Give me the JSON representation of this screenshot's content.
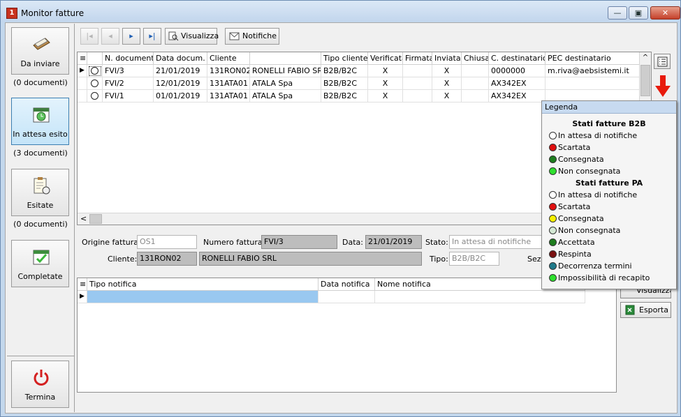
{
  "window": {
    "title": "Monitor fatture",
    "minimize": "▭",
    "maximize": "▣",
    "close": "✕"
  },
  "nav": [
    {
      "label": "Da inviare",
      "count": "(0 documenti)",
      "icon": "send-documents-icon"
    },
    {
      "label": "In attesa esito",
      "count": "(3 documenti)",
      "icon": "pending-calendar-icon"
    },
    {
      "label": "Esitate",
      "count": "(0 documenti)",
      "icon": "clipboard-clock-icon"
    },
    {
      "label": "Completate",
      "count": "",
      "icon": "calendar-check-icon"
    }
  ],
  "terminate": {
    "label": "Termina",
    "icon": "power-icon"
  },
  "toolbar": {
    "first": "|◂",
    "prev": "◂",
    "next": "▸",
    "last": "▸|",
    "visualizza": "Visualizza",
    "notifiche": "Notifiche"
  },
  "grid": {
    "columns": [
      "≡",
      "N. documento",
      "Data docum.",
      "Cliente",
      "",
      "Tipo cliente",
      "Verificata",
      "Firmata",
      "Inviata",
      "Chiusa",
      "C. destinatario",
      "PEC destinatario"
    ],
    "rows": [
      {
        "doc": "FVI/3",
        "date": "21/01/2019",
        "client": "131RON02",
        "name": "RONELLI FABIO SRL",
        "type": "B2B/B2C",
        "verificata": "X",
        "firmata": "",
        "inviata": "X",
        "chiusa": "",
        "dest": "0000000",
        "pec": "m.riva@aebsistemi.it"
      },
      {
        "doc": "FVI/2",
        "date": "12/01/2019",
        "client": "131ATA01",
        "name": "ATALA Spa",
        "type": "B2B/B2C",
        "verificata": "X",
        "firmata": "",
        "inviata": "X",
        "chiusa": "",
        "dest": "AX342EX",
        "pec": ""
      },
      {
        "doc": "FVI/1",
        "date": "01/01/2019",
        "client": "131ATA01",
        "name": "ATALA Spa",
        "type": "B2B/B2C",
        "verificata": "X",
        "firmata": "",
        "inviata": "X",
        "chiusa": "",
        "dest": "AX342EX",
        "pec": ""
      }
    ],
    "scroll_left": "<",
    "scroll_up": "^"
  },
  "form": {
    "origine_label": "Origine fattura:",
    "origine_value": "OS1",
    "numero_label": "Numero fattura:",
    "numero_value": "FVI/3",
    "data_label": "Data:",
    "data_value": "21/01/2019",
    "stato_label": "Stato:",
    "stato_value": "In attesa di notifiche",
    "cliente_label": "Cliente:",
    "cliente_code": "131RON02",
    "cliente_name": "RONELLI FABIO SRL",
    "tipo_label": "Tipo:",
    "tipo_value": "B2B/B2C",
    "sez_label": "Sezi"
  },
  "notif_grid": {
    "columns": [
      "≡",
      "Tipo notifica",
      "Data notifica",
      "Nome notifica"
    ]
  },
  "right_buttons": {
    "visualizza": "Visualizza",
    "esporta": "Esporta"
  },
  "legend": {
    "title": "Legenda",
    "b2b_title": "Stati fatture B2B",
    "b2b": [
      {
        "label": "In attesa di notifiche",
        "color": "#ffffff"
      },
      {
        "label": "Scartata",
        "color": "#e01010"
      },
      {
        "label": "Consegnata",
        "color": "#1e7d1e"
      },
      {
        "label": "Non consegnata",
        "color": "#2ee02e"
      }
    ],
    "pa_title": "Stati fatture PA",
    "pa": [
      {
        "label": "In attesa di notifiche",
        "color": "#ffffff"
      },
      {
        "label": "Scartata",
        "color": "#e01010"
      },
      {
        "label": "Consegnata",
        "color": "#f5f000"
      },
      {
        "label": "Non consegnata",
        "color": "#d4e8d4"
      },
      {
        "label": "Accettata",
        "color": "#1e7d1e"
      },
      {
        "label": "Respinta",
        "color": "#7a1010"
      },
      {
        "label": "Decorrenza termini",
        "color": "#1f7a8a"
      },
      {
        "label": "Impossibilità di recapito",
        "color": "#2ee02e"
      }
    ]
  }
}
